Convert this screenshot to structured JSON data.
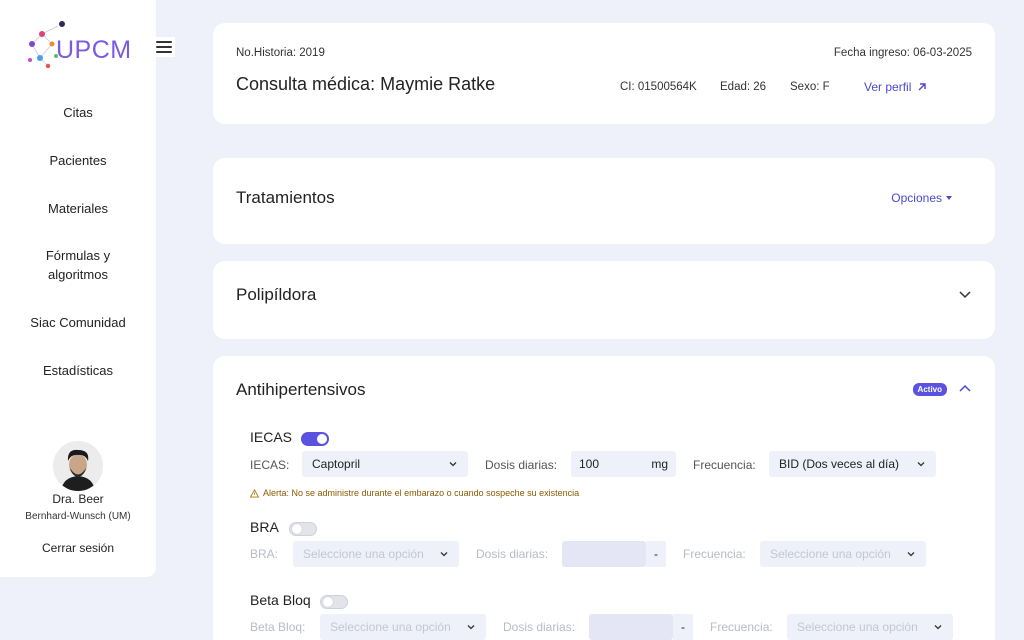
{
  "sidebar": {
    "logo_text": "UPCM",
    "nav": [
      "Citas",
      "Pacientes",
      "Materiales",
      "Fórmulas y algoritmos",
      "Siac Comunidad",
      "Estadísticas"
    ],
    "user_name": "Dra. Beer",
    "user_org": "Bernhard-Wunsch (UM)",
    "logout": "Cerrar sesión"
  },
  "header": {
    "historia": "No.Historia: 2019",
    "fecha": "Fecha ingreso: 06-03-2025",
    "title": "Consulta médica: Maymie Ratke",
    "ci": "CI: 01500564K",
    "edad": "Edad: 26",
    "sexo": "Sexo: F",
    "perfil": "Ver perfil"
  },
  "tratamientos": {
    "title": "Tratamientos",
    "opciones": "Opciones"
  },
  "polipildora": {
    "title": "Polipíldora"
  },
  "antihipertensivos": {
    "title": "Antihipertensivos",
    "badge": "Activo",
    "iecas": {
      "title": "IECAS",
      "enabled": true,
      "label": "IECAS:",
      "value": "Captopril",
      "dosis_label": "Dosis diarias:",
      "dosis_value": "100",
      "unit": "mg",
      "freq_label": "Frecuencia:",
      "freq_value": "BID (Dos veces al día)",
      "alert": "Alerta: No se administre durante el embarazo o cuando sospeche su existencia"
    },
    "bra": {
      "title": "BRA",
      "enabled": false,
      "label": "BRA:",
      "placeholder": "Seleccione una opción",
      "dosis_label": "Dosis diarias:",
      "unit": "-",
      "freq_label": "Frecuencia:",
      "freq_placeholder": "Seleccione una opción"
    },
    "beta": {
      "title": "Beta Bloq",
      "enabled": false,
      "label": "Beta Bloq:",
      "placeholder": "Seleccione una opción",
      "dosis_label": "Dosis diarias:",
      "unit": "-",
      "freq_label": "Frecuencia:",
      "freq_placeholder": "Seleccione una opción"
    }
  },
  "colors": {
    "accent": "#5b52e0",
    "link": "#4a48d4",
    "bg": "#eef0fa"
  }
}
